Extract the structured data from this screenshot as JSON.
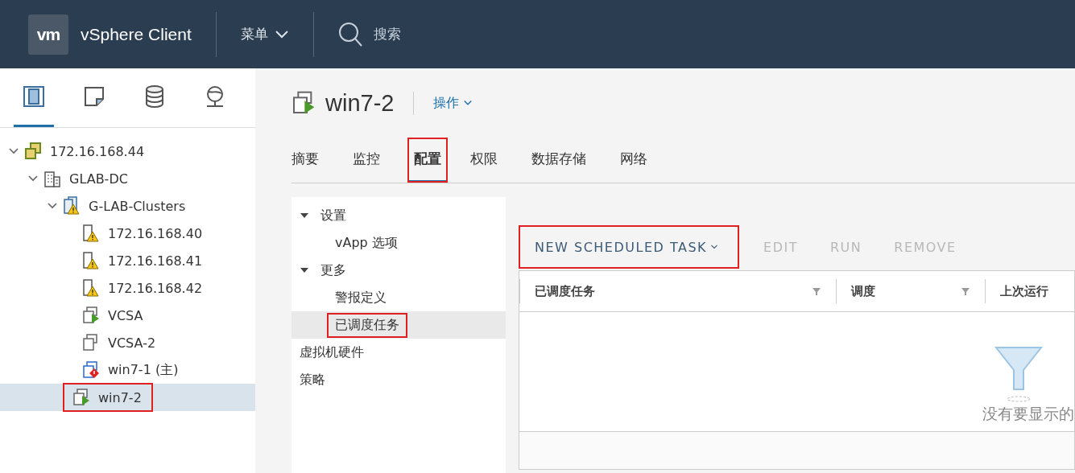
{
  "header": {
    "logo": "vm",
    "title": "vSphere Client",
    "menu": "菜单",
    "search": "搜索"
  },
  "sidebar": {
    "view_tabs": [
      {
        "kind": "hosts",
        "selected": true
      },
      {
        "kind": "vms",
        "selected": false
      },
      {
        "kind": "storage",
        "selected": false
      },
      {
        "kind": "network",
        "selected": false
      }
    ],
    "tree": [
      {
        "label": "172.16.168.44",
        "kind": "vcenter",
        "expanded": true,
        "selected": false,
        "highlighted": false,
        "children": [
          {
            "label": "GLAB-DC",
            "kind": "datacenter",
            "expanded": true,
            "selected": false,
            "highlighted": false,
            "children": [
              {
                "label": "G-LAB-Clusters",
                "kind": "cluster",
                "expanded": true,
                "selected": false,
                "highlighted": false,
                "children": [
                  {
                    "label": "172.16.168.40",
                    "kind": "host",
                    "selected": false,
                    "highlighted": false
                  },
                  {
                    "label": "172.16.168.41",
                    "kind": "host",
                    "selected": false,
                    "highlighted": false
                  },
                  {
                    "label": "172.16.168.42",
                    "kind": "host",
                    "selected": false,
                    "highlighted": false
                  },
                  {
                    "label": "VCSA",
                    "kind": "vm-on",
                    "selected": false,
                    "highlighted": false
                  },
                  {
                    "label": "VCSA-2",
                    "kind": "vm-off",
                    "selected": false,
                    "highlighted": false
                  },
                  {
                    "label": "win7-1 (主)",
                    "kind": "vm-alert",
                    "selected": false,
                    "highlighted": false
                  },
                  {
                    "label": "win7-2",
                    "kind": "vm-on",
                    "selected": true,
                    "highlighted": true
                  }
                ]
              }
            ]
          }
        ]
      }
    ]
  },
  "object": {
    "title": "win7-2",
    "actions": "操作"
  },
  "tabs": [
    {
      "label": "摘要",
      "selected": false,
      "highlighted": false
    },
    {
      "label": "监控",
      "selected": false,
      "highlighted": false
    },
    {
      "label": "配置",
      "selected": true,
      "highlighted": true
    },
    {
      "label": "权限",
      "selected": false,
      "highlighted": false
    },
    {
      "label": "数据存储",
      "selected": false,
      "highlighted": false
    },
    {
      "label": "网络",
      "selected": false,
      "highlighted": false
    }
  ],
  "config_nav": [
    {
      "label": "设置",
      "expanded": true,
      "selected": false,
      "highlighted": false,
      "children": [
        {
          "label": "vApp 选项",
          "selected": false,
          "highlighted": false
        }
      ]
    },
    {
      "label": "更多",
      "expanded": true,
      "selected": false,
      "highlighted": false,
      "children": [
        {
          "label": "警报定义",
          "selected": false,
          "highlighted": false
        },
        {
          "label": "已调度任务",
          "selected": true,
          "highlighted": true
        }
      ]
    },
    {
      "label": "虚拟机硬件",
      "selected": false,
      "highlighted": false
    },
    {
      "label": "策略",
      "selected": false,
      "highlighted": false
    }
  ],
  "toolbar": [
    {
      "label": "NEW SCHEDULED TASK",
      "disabled": false,
      "dropdown": true,
      "highlighted": true
    },
    {
      "label": "EDIT",
      "disabled": true,
      "dropdown": false,
      "highlighted": false
    },
    {
      "label": "RUN",
      "disabled": true,
      "dropdown": false,
      "highlighted": false
    },
    {
      "label": "REMOVE",
      "disabled": true,
      "dropdown": false,
      "highlighted": false
    }
  ],
  "table": {
    "columns": [
      {
        "label": "已调度任务",
        "filter": true
      },
      {
        "label": "调度",
        "filter": true
      },
      {
        "label": "上次运行"
      }
    ],
    "empty_message": "没有要显示的"
  }
}
